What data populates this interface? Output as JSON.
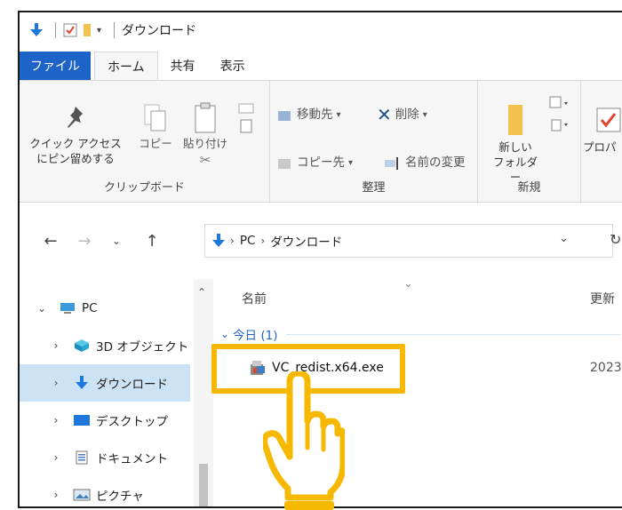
{
  "window": {
    "title": "ダウンロード"
  },
  "ribbon_tabs": [
    {
      "label": "ファイル"
    },
    {
      "label": "ホーム"
    },
    {
      "label": "共有"
    },
    {
      "label": "表示"
    }
  ],
  "clipboard": {
    "pin_line1": "クイック アクセス",
    "pin_line2": "にピン留めする",
    "copy": "コピー",
    "paste": "貼り付け",
    "label": "クリップボード"
  },
  "organize": {
    "move_to": "移動先",
    "delete": "削除",
    "copy_to": "コピー先",
    "rename": "名前の変更",
    "label": "整理"
  },
  "new_group": {
    "new_folder_line1": "新しい",
    "new_folder_line2": "フォルダー",
    "label": "新規"
  },
  "open_group": {
    "properties": "プロパ"
  },
  "address": {
    "crumb_pc": "PC",
    "crumb_folder": "ダウンロード"
  },
  "nav_tree": [
    {
      "label": "PC"
    },
    {
      "label": "3D オブジェクト"
    },
    {
      "label": "ダウンロード"
    },
    {
      "label": "デスクトップ"
    },
    {
      "label": "ドキュメント"
    },
    {
      "label": "ピクチャ"
    }
  ],
  "file_list": {
    "col_name": "名前",
    "col_date": "更新",
    "group_label": "今日 (1)",
    "files": [
      {
        "name": "VC_redist.x64.exe",
        "date": "2023"
      }
    ]
  },
  "colors": {
    "accent": "#1e64c8",
    "highlight": "#f6b800",
    "selected": "#cce3f5"
  }
}
